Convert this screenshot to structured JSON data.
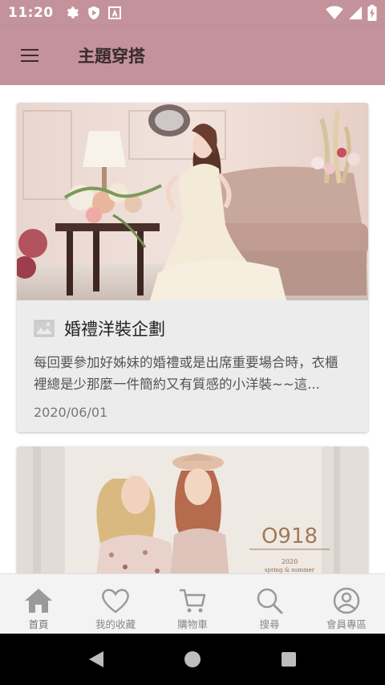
{
  "status_bar": {
    "time": "11:20",
    "icons_left": [
      "gear-icon",
      "shield-play-icon",
      "a-notification-icon"
    ],
    "icons_right": [
      "wifi-icon",
      "signal-icon",
      "battery-charging-icon"
    ]
  },
  "app_bar": {
    "title": "主題穿搭",
    "background": "#c4929b",
    "menu_icon": "menu-icon"
  },
  "articles": [
    {
      "title": "婚禮洋裝企劃",
      "description": "每回要參加好姊妹的婚禮或是出席重要場合時，衣櫃裡總是少那麼一件簡約又有質感的小洋裝~~這...",
      "date": "2020/06/01",
      "image": "woman-in-lace-dress-photo"
    },
    {
      "image": "two-models-photo",
      "brand_text": "O918",
      "image_caption_year": "2020",
      "image_caption": "spring & summer"
    }
  ],
  "bottom_nav": {
    "items": [
      {
        "label": "首頁",
        "icon": "home-icon",
        "active": true
      },
      {
        "label": "我的收藏",
        "icon": "heart-icon",
        "active": false
      },
      {
        "label": "購物車",
        "icon": "cart-icon",
        "active": false
      },
      {
        "label": "搜尋",
        "icon": "search-icon",
        "active": false
      },
      {
        "label": "會員專區",
        "icon": "account-icon",
        "active": false
      }
    ]
  },
  "system_nav": [
    "back-icon",
    "home-circle-icon",
    "recents-icon"
  ]
}
